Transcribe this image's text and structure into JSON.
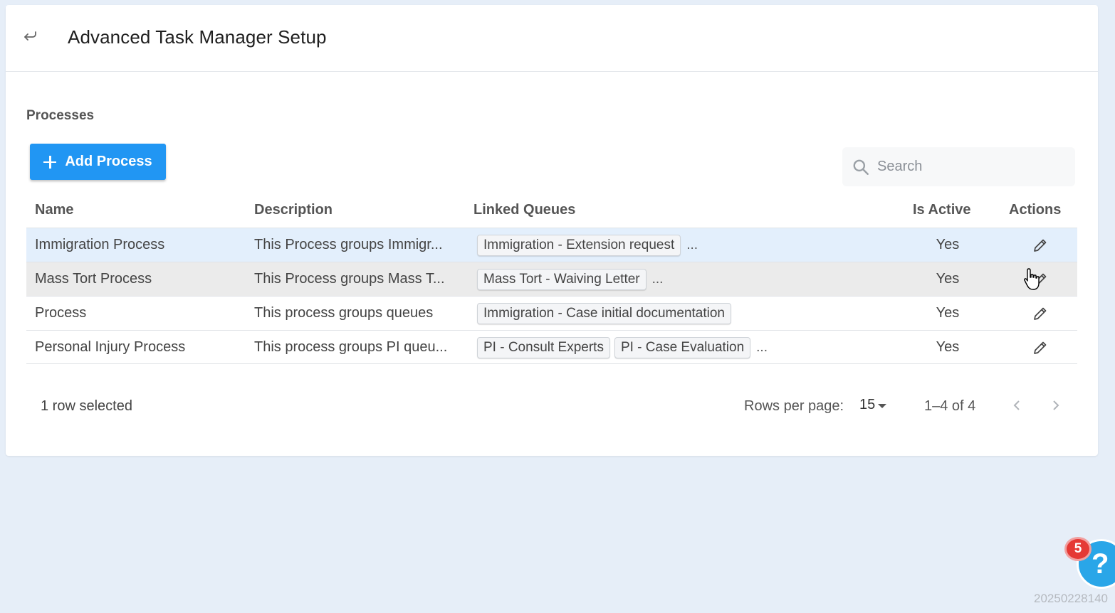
{
  "header": {
    "title": "Advanced Task Manager Setup",
    "back_icon": "return-arrow-icon"
  },
  "section": {
    "title": "Processes"
  },
  "toolbar": {
    "add_label": "Add Process"
  },
  "search": {
    "placeholder": "Search",
    "value": ""
  },
  "table": {
    "columns": [
      "Name",
      "Description",
      "Linked Queues",
      "Is Active",
      "Actions"
    ],
    "rows": [
      {
        "name": "Immigration Process",
        "description": "This Process groups Immigr...",
        "queues": [
          "Immigration - Extension request"
        ],
        "more": "...",
        "active": "Yes",
        "state": "selected"
      },
      {
        "name": "Mass Tort Process",
        "description": "This Process groups Mass T...",
        "queues": [
          "Mass Tort - Waiving Letter"
        ],
        "more": "...",
        "active": "Yes",
        "state": "hovered"
      },
      {
        "name": "Process",
        "description": "This process groups queues",
        "queues": [
          "Immigration - Case initial documentation"
        ],
        "more": "",
        "active": "Yes",
        "state": "normal"
      },
      {
        "name": "Personal Injury Process",
        "description": "This process groups PI queu...",
        "queues": [
          "PI - Consult Experts",
          "PI - Case Evaluation"
        ],
        "more": "...",
        "active": "Yes",
        "state": "normal"
      }
    ]
  },
  "footer": {
    "selection_status": "1 row selected",
    "rows_per_page_label": "Rows per page:",
    "rows_per_page_value": "15",
    "range": "1–4 of 4"
  },
  "help": {
    "badge_count": "5",
    "symbol": "?"
  },
  "build_id": "2025022814​0",
  "colors": {
    "accent": "#2196f3",
    "selected_row": "#e3effc",
    "hover_row": "#ebebeb",
    "background": "#e6eef8",
    "badge": "#e53935"
  }
}
